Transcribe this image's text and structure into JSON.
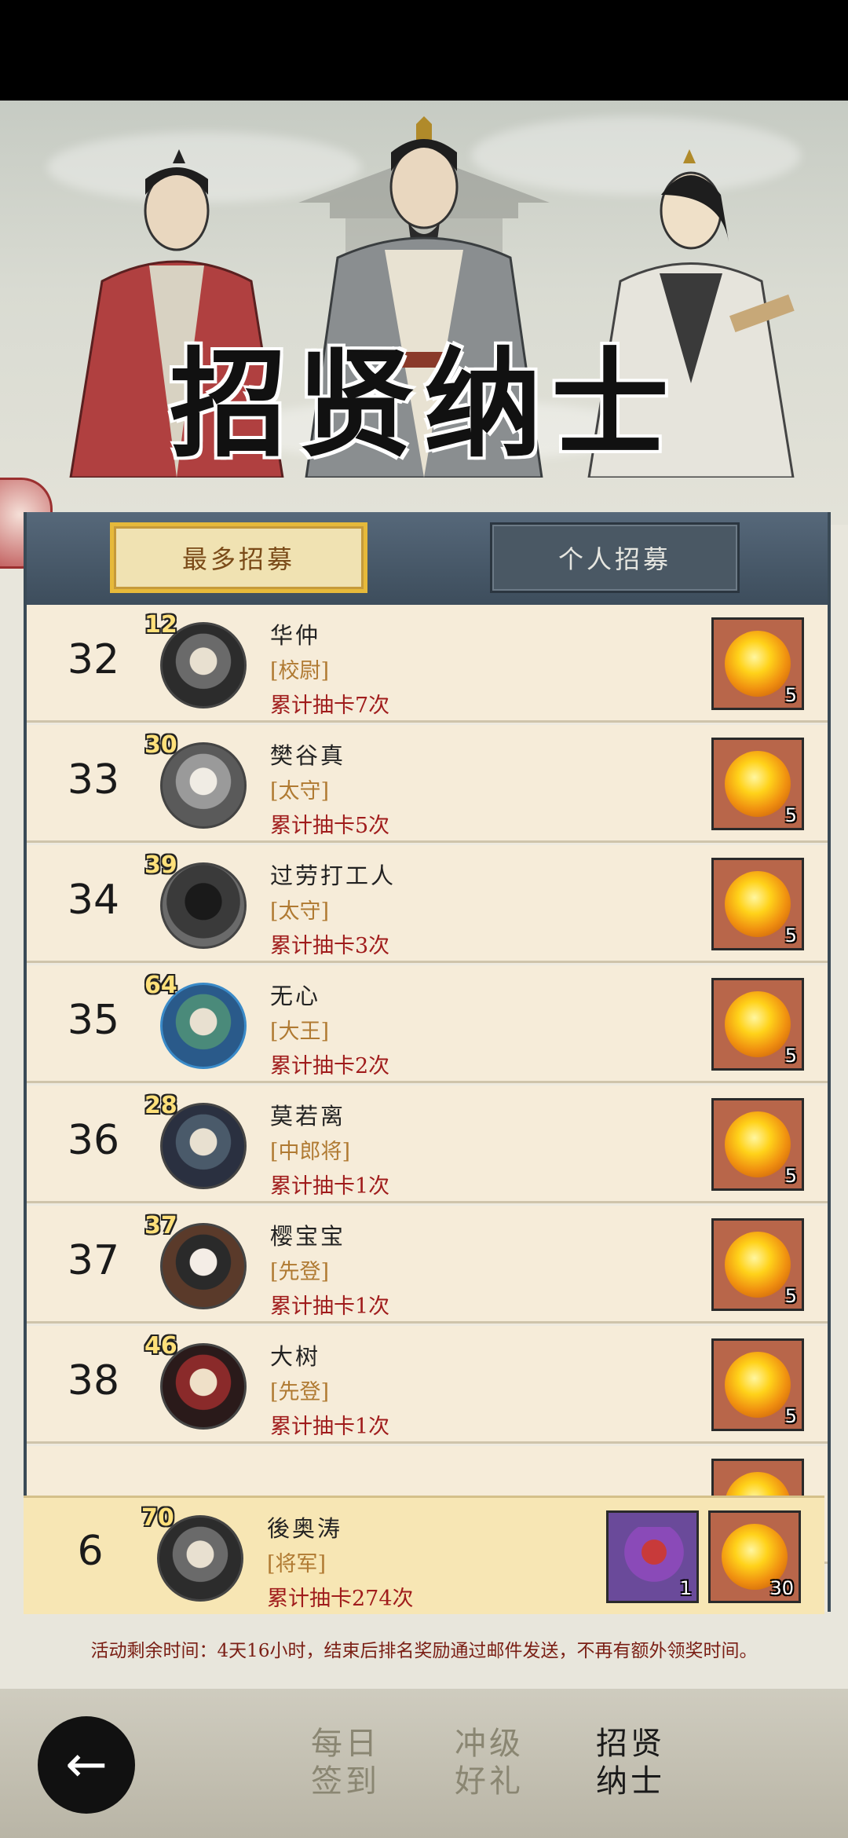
{
  "event": {
    "title": "招贤纳士",
    "notice": "活动剩余时间：4天16小时，结束后排名奖励通过邮件发送，不再有额外领奖时间。"
  },
  "tabs": [
    {
      "label": "最多招募",
      "active": true
    },
    {
      "label": "个人招募",
      "active": false
    }
  ],
  "ranking": [
    {
      "rank": "32",
      "level": "12",
      "name": "华仲",
      "title": "[校尉]",
      "draws": "累计抽卡7次",
      "reward_qty": "5"
    },
    {
      "rank": "33",
      "level": "30",
      "name": "樊谷真",
      "title": "[太守]",
      "draws": "累计抽卡5次",
      "reward_qty": "5"
    },
    {
      "rank": "34",
      "level": "39",
      "name": "过劳打工人",
      "title": "[太守]",
      "draws": "累计抽卡3次",
      "reward_qty": "5"
    },
    {
      "rank": "35",
      "level": "64",
      "name": "无心",
      "title": "[大王]",
      "draws": "累计抽卡2次",
      "reward_qty": "5"
    },
    {
      "rank": "36",
      "level": "28",
      "name": "莫若离",
      "title": "[中郎将]",
      "draws": "累计抽卡1次",
      "reward_qty": "5"
    },
    {
      "rank": "37",
      "level": "37",
      "name": "樱宝宝",
      "title": "[先登]",
      "draws": "累计抽卡1次",
      "reward_qty": "5"
    },
    {
      "rank": "38",
      "level": "46",
      "name": "大树",
      "title": "[先登]",
      "draws": "累计抽卡1次",
      "reward_qty": "5"
    }
  ],
  "my_rank": {
    "rank": "6",
    "level": "70",
    "name": "後奥涛",
    "title": "[将军]",
    "draws": "累计抽卡274次",
    "rewards": [
      {
        "type": "general-card",
        "qty": "1"
      },
      {
        "type": "fire-orb",
        "qty": "30"
      }
    ]
  },
  "bottom_nav": [
    {
      "line1": "每日",
      "line2": "签到",
      "active": false
    },
    {
      "line1": "冲级",
      "line2": "好礼",
      "active": false
    },
    {
      "line1": "招贤",
      "line2": "纳士",
      "active": true
    }
  ],
  "icons": {
    "back": "back-arrow-icon",
    "reward": "fire-orb-icon"
  },
  "colors": {
    "accent_gold": "#e6b93a",
    "draw_count_red": "#a01c1c",
    "title_brown": "#b07a32",
    "tab_bar": "#3d4d5c"
  }
}
